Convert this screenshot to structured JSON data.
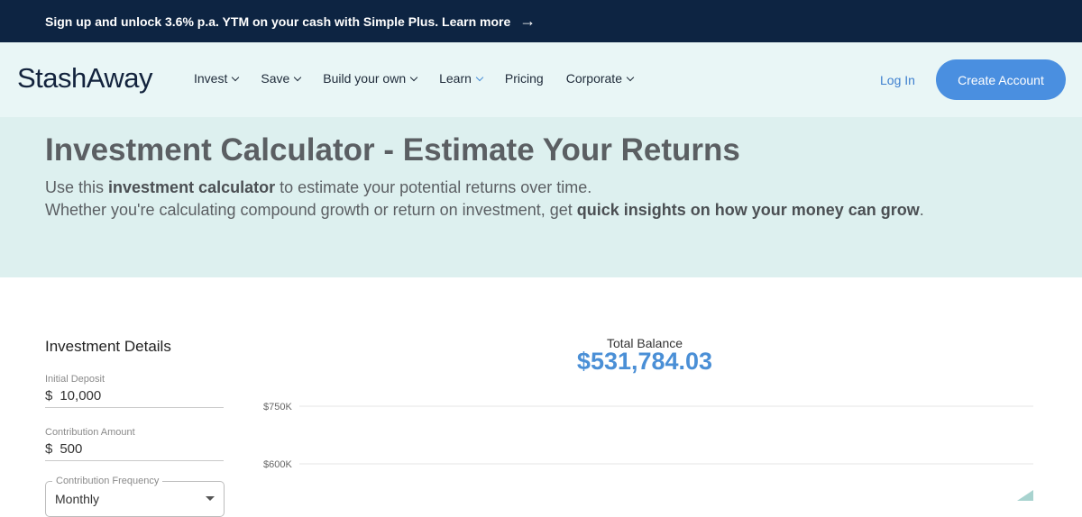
{
  "promo": {
    "text": "Sign up and unlock 3.6% p.a. YTM on your cash with Simple Plus. Learn more",
    "arrow": "→"
  },
  "header": {
    "logo": "StashAway",
    "nav": [
      {
        "label": "Invest",
        "has_dropdown": true
      },
      {
        "label": "Save",
        "has_dropdown": true
      },
      {
        "label": "Build your own",
        "has_dropdown": true
      },
      {
        "label": "Learn",
        "has_dropdown": true
      },
      {
        "label": "Pricing",
        "has_dropdown": false
      },
      {
        "label": "Corporate",
        "has_dropdown": true
      }
    ],
    "login": "Log In",
    "create_account": "Create Account"
  },
  "hero": {
    "title": "Investment Calculator - Estimate Your Returns",
    "line1_pre": "Use this ",
    "line1_bold": "investment calculator",
    "line1_post": " to estimate your potential returns over time.",
    "line2_pre": "Whether you're calculating compound growth or return on investment, get ",
    "line2_bold": "quick insights on how your money can grow",
    "line2_post": "."
  },
  "details": {
    "title": "Investment Details",
    "initial_deposit": {
      "label": "Initial Deposit",
      "currency": "$",
      "value": "10,000"
    },
    "contribution_amount": {
      "label": "Contribution Amount",
      "currency": "$",
      "value": "500"
    },
    "contribution_frequency": {
      "label": "Contribution Frequency",
      "value": "Monthly"
    }
  },
  "balance": {
    "label": "Total Balance",
    "value": "$531,784.03"
  },
  "chart_data": {
    "type": "area",
    "y_ticks": [
      "$750K",
      "$600K"
    ],
    "y_tick_values": [
      750000,
      600000
    ],
    "grid": true
  },
  "colors": {
    "accent": "#4a8fe0",
    "navy": "#0d2442",
    "hero_bg": "#ddf0ef"
  }
}
